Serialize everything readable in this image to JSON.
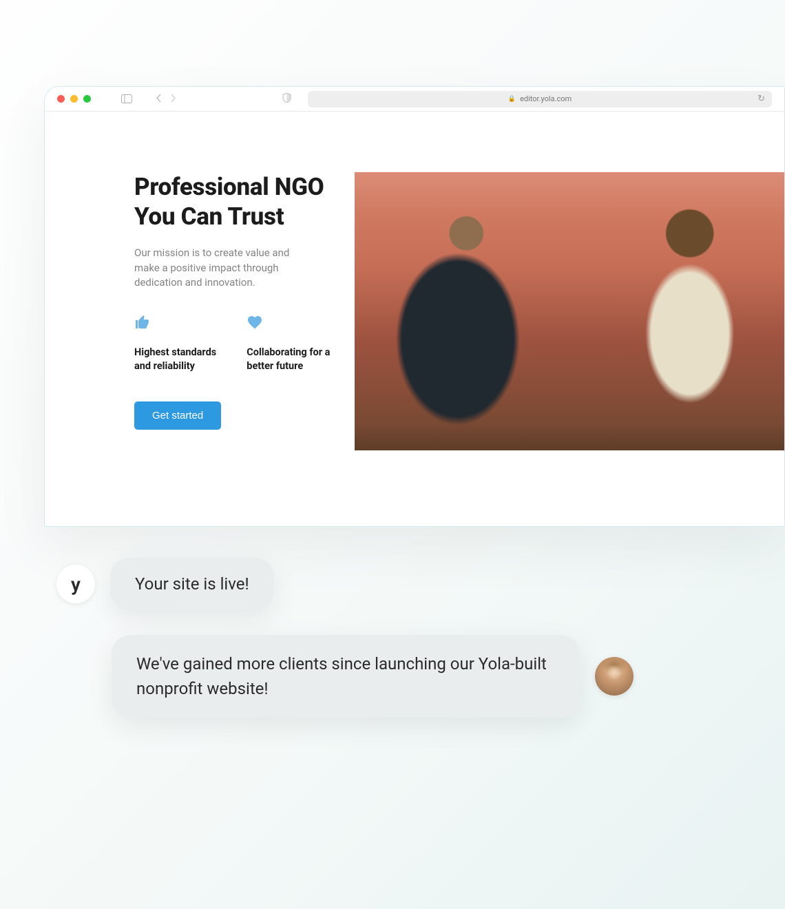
{
  "browser": {
    "url": "editor.yola.com"
  },
  "hero": {
    "title": "Professional NGO You Can Trust",
    "subtitle": "Our mission is to create value and make a positive impact through dedication and innovation.",
    "features": [
      {
        "label": "Highest standards and reliability"
      },
      {
        "label": "Collaborating for a better future"
      }
    ],
    "cta": "Get started"
  },
  "chat": {
    "yola_initial": "y",
    "message1": "Your site is live!",
    "message2": "We've gained more clients since launching our Yola-built nonprofit website!"
  }
}
